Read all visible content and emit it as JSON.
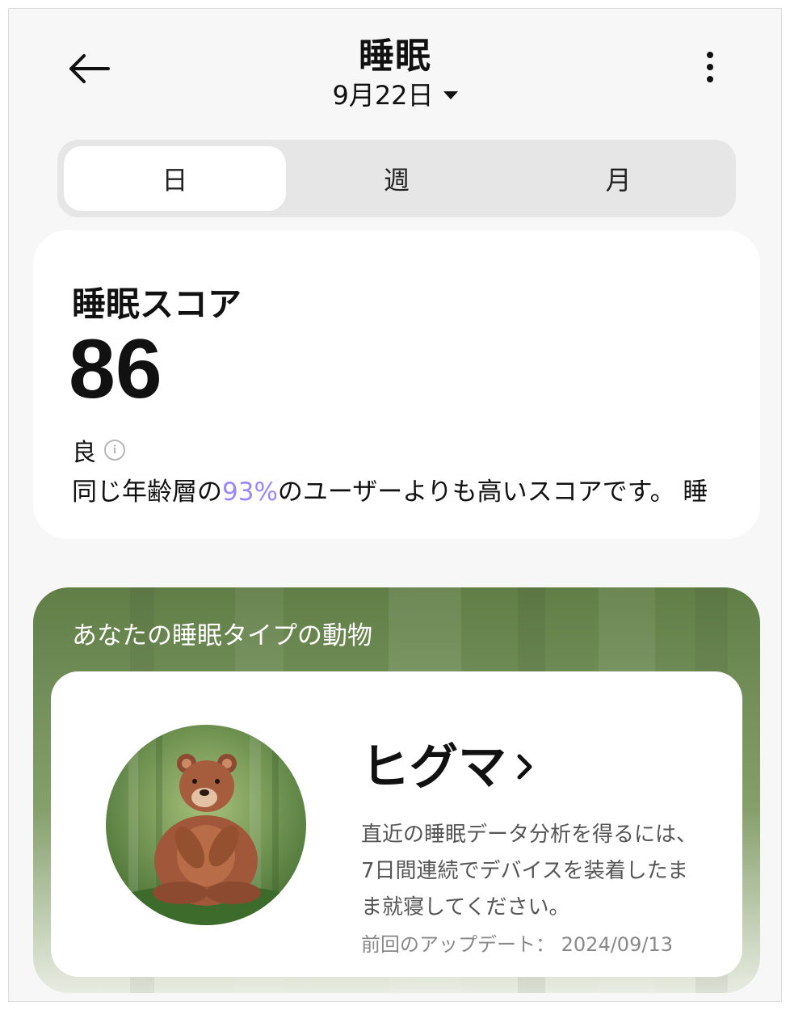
{
  "header": {
    "title": "睡眠",
    "date": "9月22日"
  },
  "tabs": [
    {
      "label": "日",
      "active": true
    },
    {
      "label": "週",
      "active": false
    },
    {
      "label": "月",
      "active": false
    }
  ],
  "score": {
    "title": "睡眠スコア",
    "value": "86",
    "rating": "良",
    "compare_prefix": "同じ年齢層の",
    "compare_percent": "93%",
    "compare_suffix": "のユーザーよりも高いスコアです。 睡"
  },
  "animal": {
    "heading": "あなたの睡眠タイプの動物",
    "name": "ヒグマ",
    "description": "直近の睡眠データ分析を得るには、7日間連続でデバイスを装着したまま就寝してください。",
    "update_label": "前回のアップデート：",
    "update_date": "2024/09/13"
  },
  "colors": {
    "page_bg": "#f7f7f7",
    "card_bg": "#ffffff",
    "highlight": "#9a86ff",
    "forest_green": "#7a9a5e",
    "bear_brown": "#a0573a"
  },
  "icons": {
    "back": "arrow-left-icon",
    "more": "more-vertical-icon",
    "date_dropdown": "caret-down-icon",
    "info": "info-icon",
    "animal_link": "chevron-right-icon"
  }
}
